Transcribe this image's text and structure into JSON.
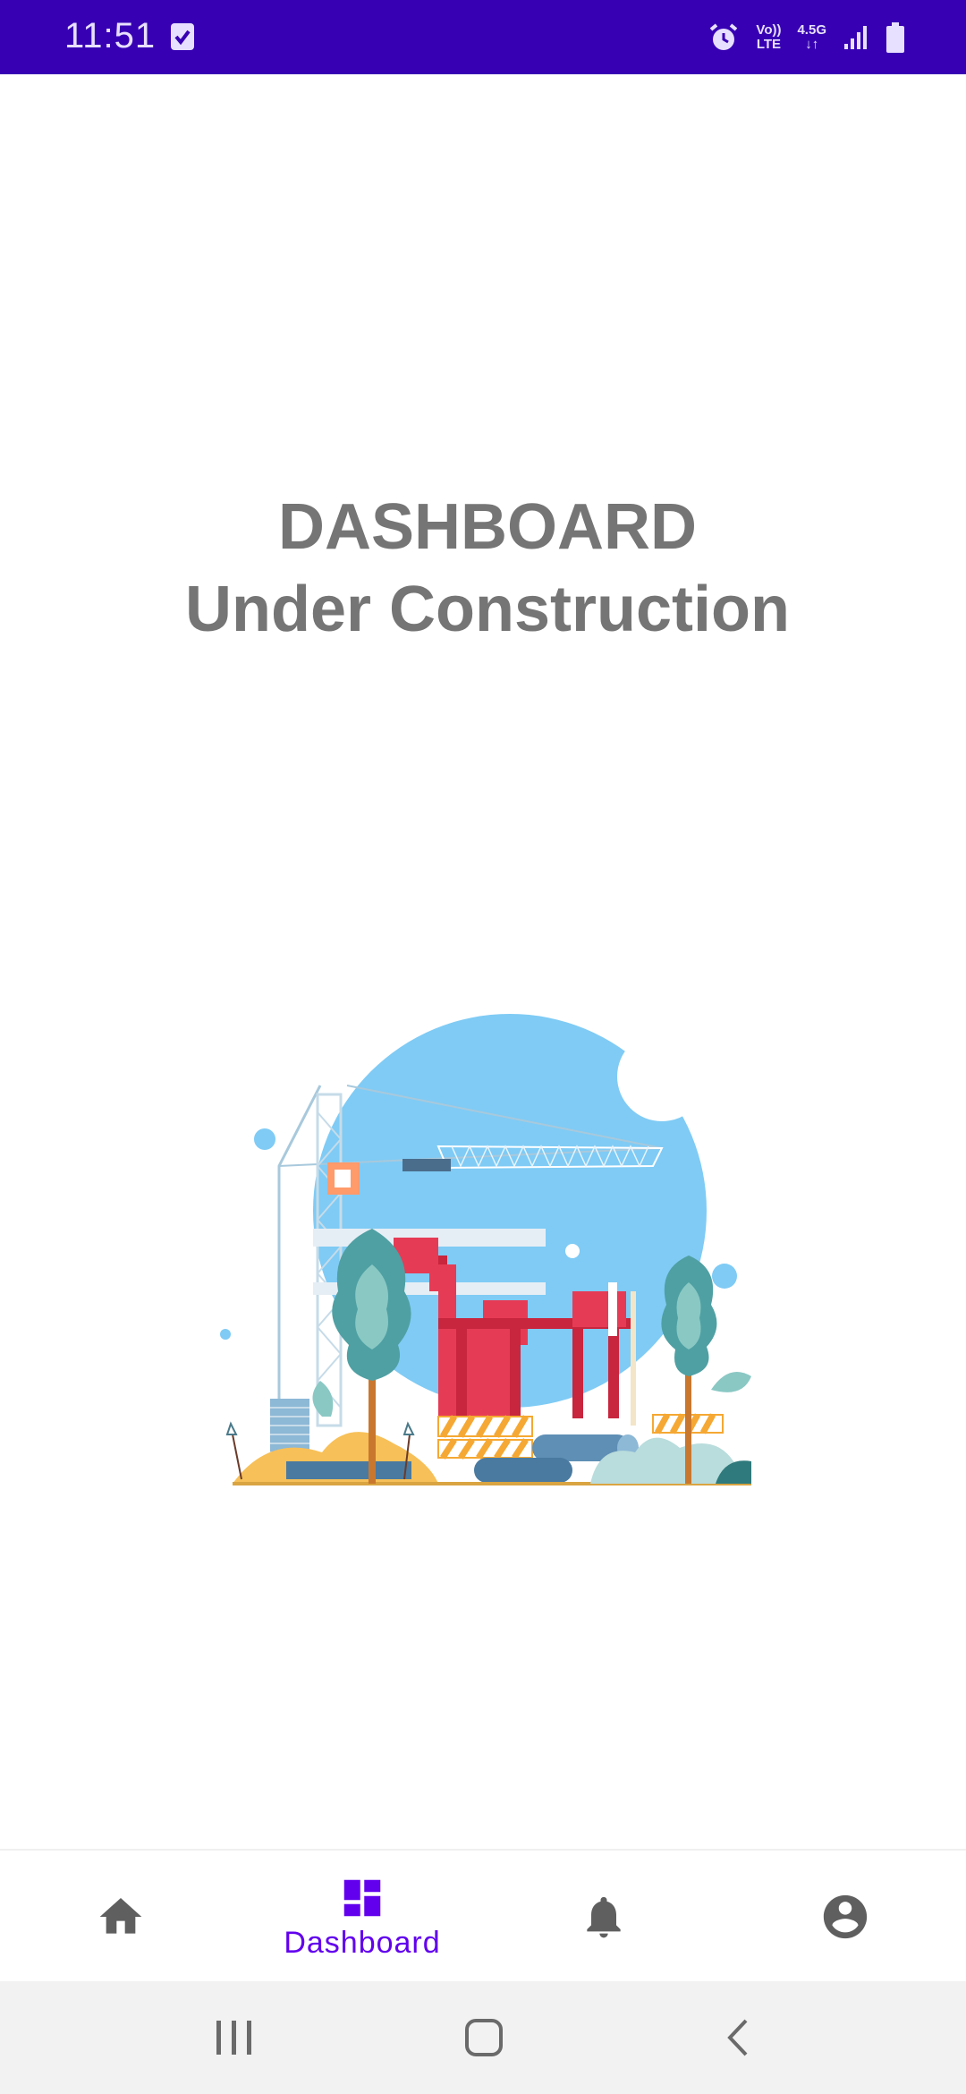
{
  "status_bar": {
    "time": "11:51",
    "volte_line1": "Vo))",
    "volte_line2": "LTE",
    "network_type": "4.5G",
    "background_color": "#3700b3"
  },
  "content": {
    "title_line1": "DASHBOARD",
    "title_line2": "Under Construction",
    "illustration": "construction-site-illustration"
  },
  "bottom_nav": {
    "items": [
      {
        "icon": "home-icon",
        "label": "",
        "selected": false
      },
      {
        "icon": "dashboard-icon",
        "label": "Dashboard",
        "selected": true
      },
      {
        "icon": "bell-icon",
        "label": "",
        "selected": false
      },
      {
        "icon": "account-circle-icon",
        "label": "",
        "selected": false
      }
    ],
    "active_color": "#6200ee",
    "inactive_color": "#5f5f5f"
  },
  "system_nav": {
    "buttons": [
      "recent-apps",
      "home",
      "back"
    ]
  }
}
